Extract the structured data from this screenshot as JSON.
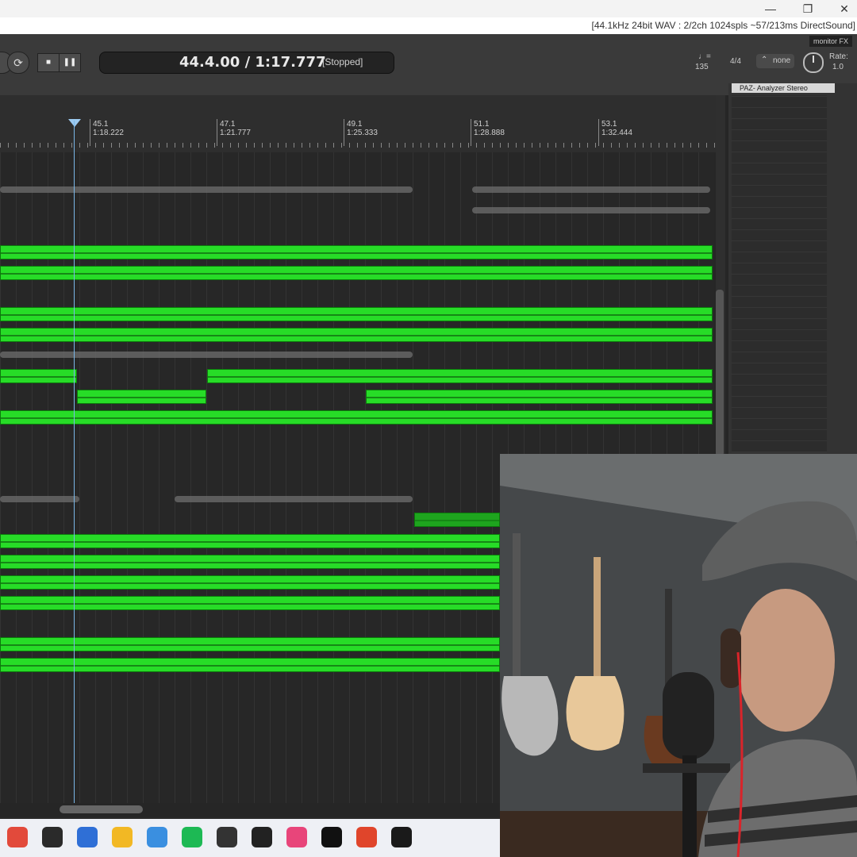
{
  "window": {
    "status_text": "[44.1kHz 24bit WAV : 2/2ch 1024spls ~57/213ms DirectSound]",
    "minimize": "—",
    "restore": "❐",
    "close": "✕"
  },
  "toolbar": {
    "monitor_fx": "monitor FX",
    "time": "44.4.00 / 1:17.777",
    "state": "[Stopped]",
    "bpm_label": "♩=",
    "bpm": "135",
    "signature": "4/4",
    "grid_label": "none",
    "rate_label": "Rate:",
    "rate": "1.0"
  },
  "ruler": {
    "markers": [
      {
        "bar": "45.1",
        "time": "1:18.222"
      },
      {
        "bar": "47.1",
        "time": "1:21.777"
      },
      {
        "bar": "49.1",
        "time": "1:25.333"
      },
      {
        "bar": "51.1",
        "time": "1:28.888"
      },
      {
        "bar": "53.1",
        "time": "1:32.444"
      }
    ]
  },
  "fx_panel": {
    "title": "PAZ- Analyzer Stereo"
  },
  "taskbar": {
    "icons": [
      "maps-icon",
      "cloud-icon",
      "notepad-icon",
      "file-explorer-icon",
      "chrome-icon",
      "spotify-icon",
      "vst-icon",
      "analytics-icon",
      "music-icon",
      "headphones-icon",
      "snip-icon",
      "obs-icon"
    ],
    "icon_colors": [
      "#e24a3b",
      "#2a2a2a",
      "#2f6fd6",
      "#f2b824",
      "#3a8fe0",
      "#1db954",
      "#333333",
      "#222222",
      "#e8457a",
      "#111111",
      "#e0452b",
      "#1a1a1a"
    ]
  }
}
